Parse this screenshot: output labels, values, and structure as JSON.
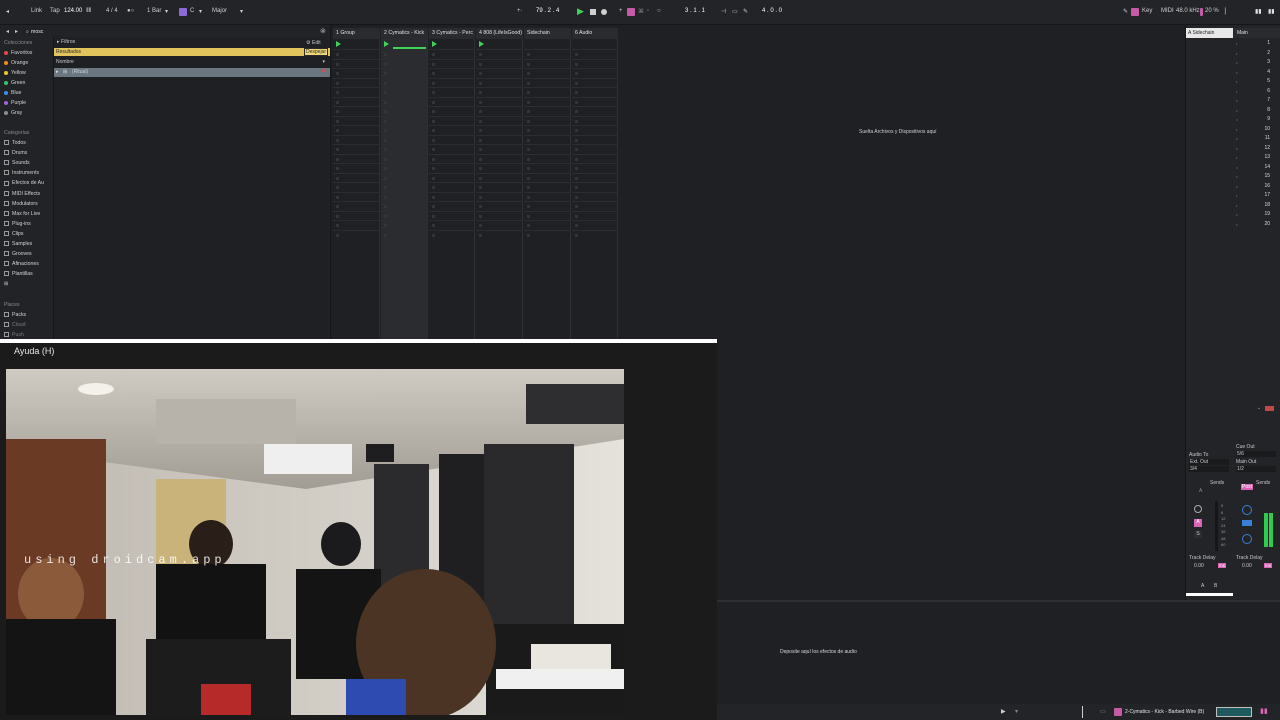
{
  "transport": {
    "link": "Link",
    "tap": "Tap",
    "tempo": "124.00",
    "time_sig": "4 / 4",
    "quantize": "1 Bar",
    "key_root": "C",
    "key_scale": "Major",
    "position": "79 .  2 .  4",
    "loop_start": "3 .  1 .  1",
    "loop_len": "4 .  0 .  0",
    "key_label": "Key",
    "midi_label": "MIDI",
    "sample_rate": "48.0 kHz",
    "cpu": "20 %"
  },
  "browser": {
    "search_value": "mosc",
    "filters_label": "Filtros",
    "edit_label": "Edit",
    "results_label": "Resultados",
    "clear_label": "Despejar",
    "name_header": "Nombre",
    "result_item": "(Ritual)",
    "collections_head": "Colecciones",
    "collections": [
      {
        "label": "Favoritos",
        "color": "#e5484d"
      },
      {
        "label": "Orange",
        "color": "#f08a24"
      },
      {
        "label": "Yellow",
        "color": "#e8c92f"
      },
      {
        "label": "Green",
        "color": "#35c46a"
      },
      {
        "label": "Blue",
        "color": "#3a8ff0"
      },
      {
        "label": "Purple",
        "color": "#a45fe0"
      },
      {
        "label": "Gray",
        "color": "#8d8d8d"
      }
    ],
    "categories_head": "Categorías",
    "categories": [
      "Todos",
      "Drums",
      "Sounds",
      "Instruments",
      "Efectos de Au",
      "MIDI Effects",
      "Modulators",
      "Max for Live",
      "Plug-ins",
      "Clips",
      "Samples",
      "Grooves",
      "Afinaciones",
      "Plantillas"
    ],
    "places_head": "Places",
    "places": [
      "Packs",
      "Cloud",
      "Push"
    ]
  },
  "session": {
    "tracks": [
      "1 Group",
      "2 Cymatics - Kick",
      "3 Cymatics - Perc",
      "4 808 (LifeIsGood)",
      "Sidechain",
      "6 Audio"
    ],
    "drop_hint": "Suelta Archivos y Dispositivos aquí"
  },
  "mixer": {
    "sidechain_label": "A Sidechain",
    "main_label": "Main",
    "scenes": [
      "1",
      "2",
      "3",
      "4",
      "5",
      "6",
      "7",
      "8",
      "9",
      "10",
      "11",
      "12",
      "13",
      "14",
      "15",
      "16",
      "17",
      "18",
      "19",
      "20"
    ],
    "audio_to": "Audio To",
    "ext_out": "Ext. Out",
    "ext_ch": "3/4",
    "cue_out": "Cue Out",
    "cue_ch": "5/6",
    "main_out": "Main Out",
    "main_ch": "1/2",
    "sends_1": "Sends",
    "sends_2": "Sends",
    "post": "Post",
    "track_delay_1": "Track Delay",
    "track_delay_2": "Track Delay",
    "delay_val_1": "0.00",
    "delay_val_2": "0.00",
    "ms": "ms",
    "a_btn": "A",
    "b_btn": "B",
    "s_btn": "S",
    "db_ticks": [
      "0",
      "6",
      "12",
      "24",
      "36",
      "48",
      "60"
    ]
  },
  "webcam": {
    "title": "Ayuda (H)",
    "watermark": "using droidcam.app"
  },
  "device": {
    "drop_hint": "Deposite aquí los efectos de audio",
    "clip_name": "2-Cymatics - Kick - Barbed Wire (B)"
  }
}
